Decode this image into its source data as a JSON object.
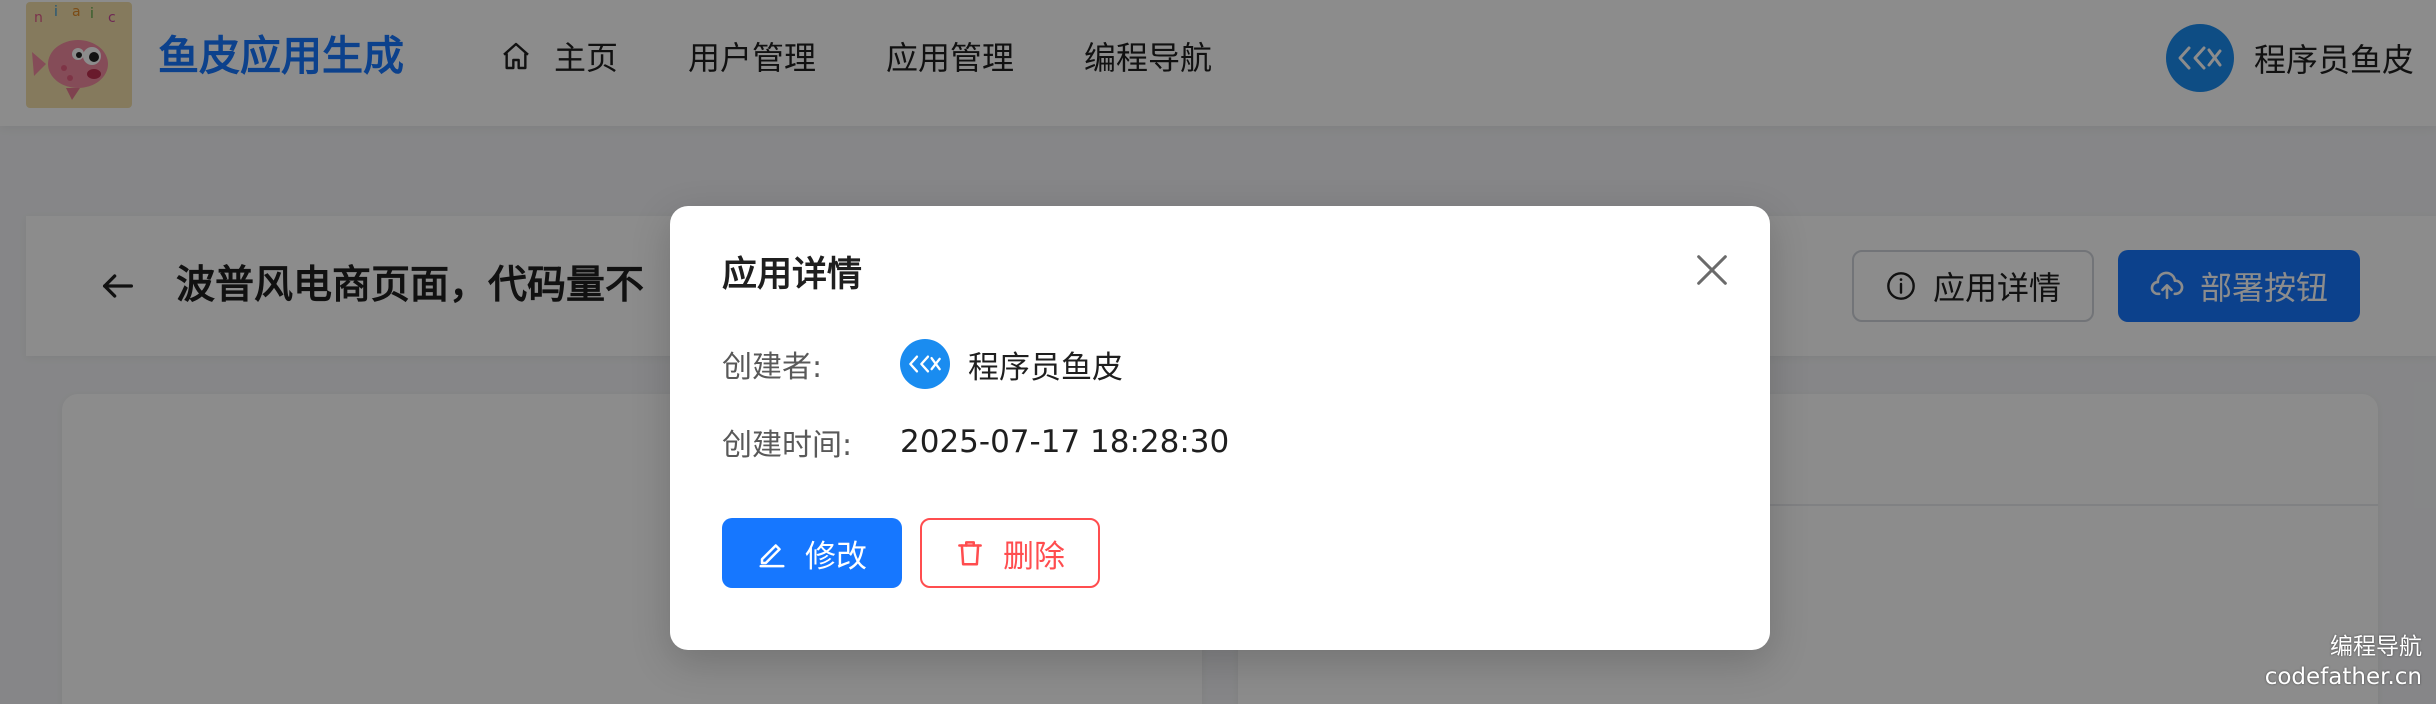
{
  "header": {
    "brand_title": "鱼皮应用生成",
    "nav": [
      {
        "label": "主页",
        "icon": "home-icon"
      },
      {
        "label": "用户管理"
      },
      {
        "label": "应用管理"
      },
      {
        "label": "编程导航"
      }
    ],
    "user_name": "程序员鱼皮"
  },
  "app_bar": {
    "app_name": "波普风电商页面，代码量不",
    "detail_button": "应用详情",
    "deploy_button": "部署按钮"
  },
  "modal": {
    "title": "应用详情",
    "creator_label": "创建者:",
    "creator_name": "程序员鱼皮",
    "created_time_label": "创建时间:",
    "created_time": "2025-07-17 18:28:30",
    "edit_button": "修改",
    "delete_button": "删除"
  },
  "watermark": {
    "line1": "编程导航",
    "line2": "codefather.cn"
  },
  "colors": {
    "primary": "#1677ff",
    "danger": "#ff4d4f",
    "avatar_bg": "#1a8cf0"
  }
}
